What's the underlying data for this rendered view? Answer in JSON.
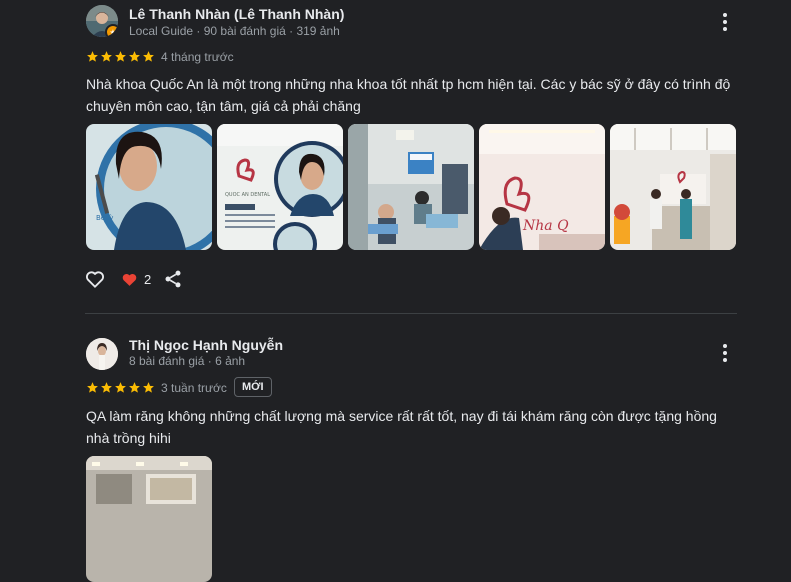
{
  "reviews": [
    {
      "name": "Lê Thanh Nhàn (Lê Thanh Nhàn)",
      "meta": "Local Guide · 90 bài đánh giá · 319 ảnh",
      "rating": 5,
      "when": "4 tháng trước",
      "text": "Nhà khoa Quốc An là một trong những nha khoa tốt nhất tp hcm hiện tại. Các y bác sỹ ở đây có trình độ chuyên môn cao, tận tâm, giá cả phải chăng",
      "photos": [
        "clinic-poster-woman",
        "clinic-poster-logo",
        "clinic-treatment-room",
        "clinic-reception-logo",
        "clinic-lobby"
      ],
      "likes": "2"
    },
    {
      "name": "Thị Ngọc Hạnh Nguyễn",
      "meta": "8 bài đánh giá · 6 ảnh",
      "rating": 5,
      "when": "3 tuần trước",
      "badge": "MỚI",
      "text": "QA làm răng không những chất lượng mà service rất rất tốt, nay đi tái khám răng còn được tặng hồng nhà trồng hihi",
      "photos": [
        "clinic-interior"
      ]
    }
  ],
  "colors": {
    "star": "#fbbc04",
    "heart": "#ea4335",
    "badge": "#f29900"
  }
}
